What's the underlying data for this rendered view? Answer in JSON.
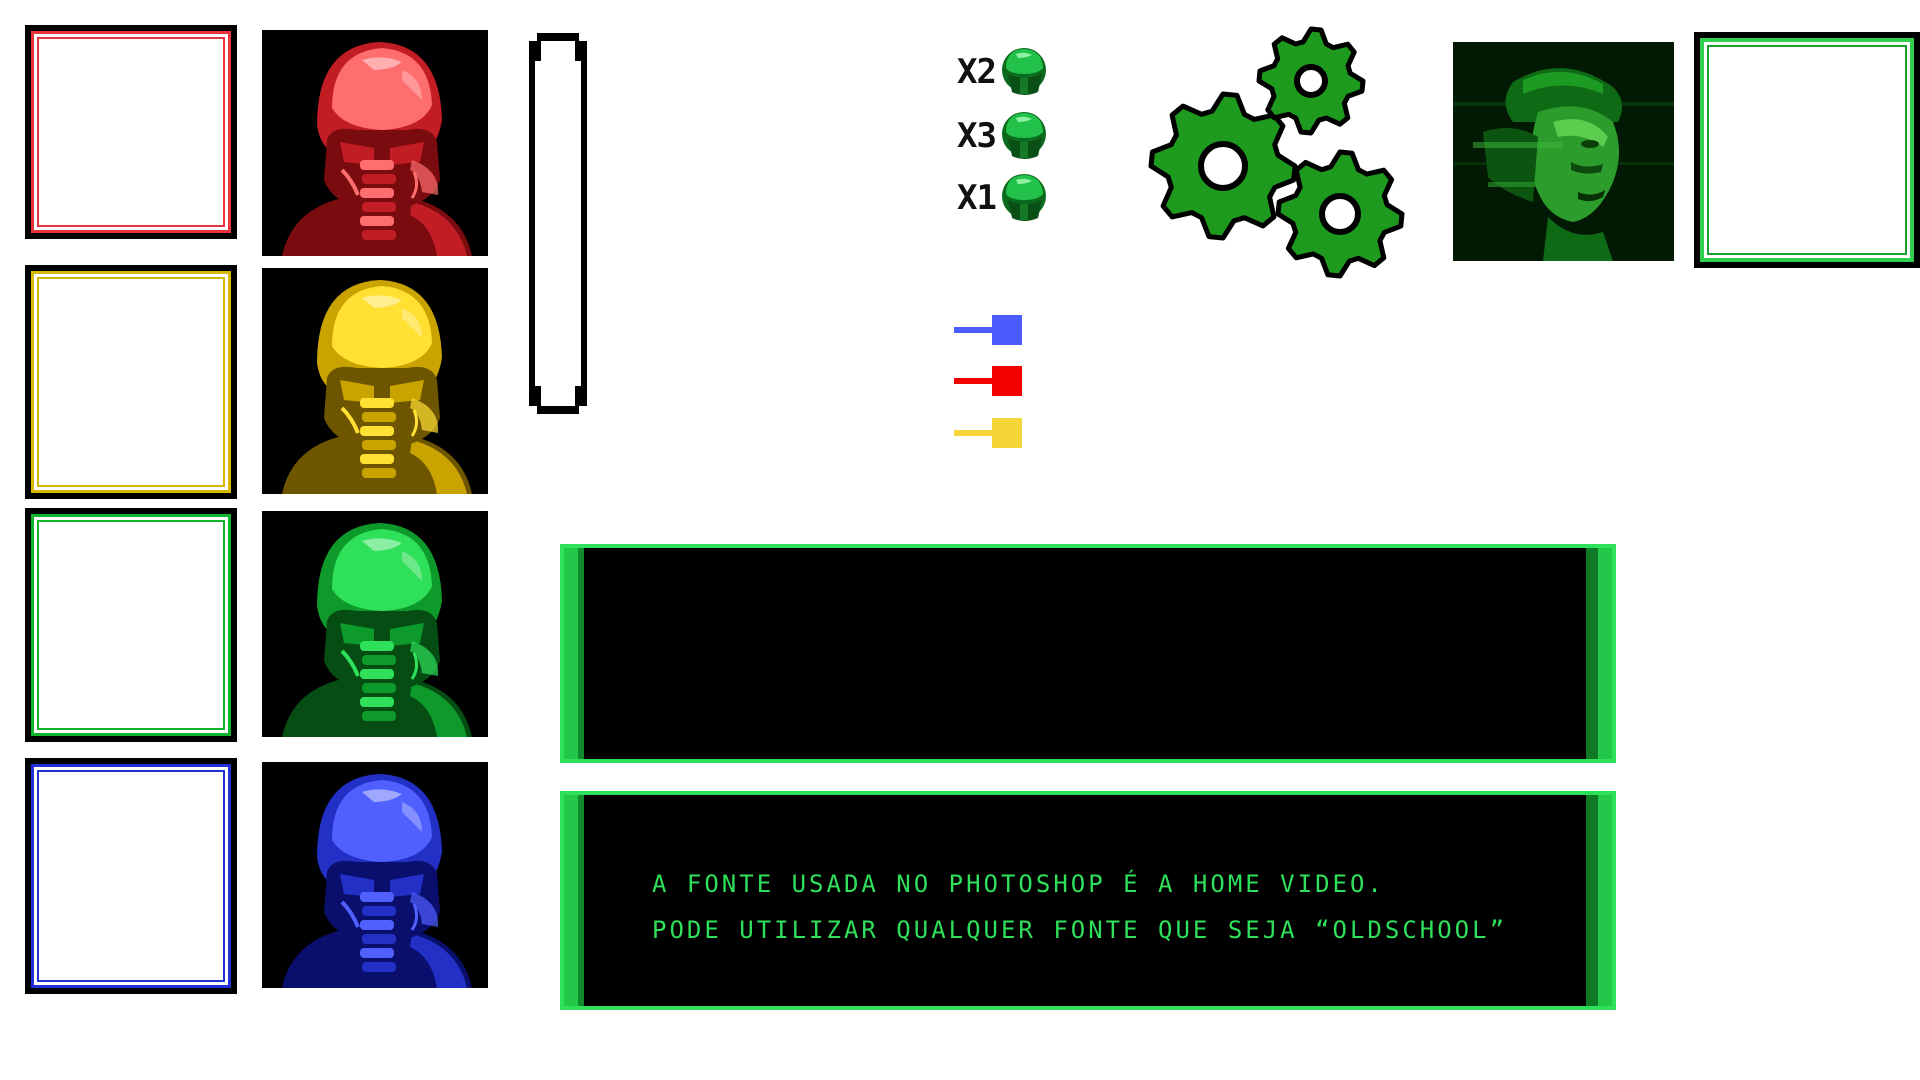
{
  "players": [
    {
      "id": "red",
      "color": "#e8353d",
      "inner": "#f24b4b",
      "dark": "#7a0c10",
      "mid": "#c21c24",
      "light": "#ff6e6e"
    },
    {
      "id": "yellow",
      "color": "#d7b800",
      "inner": "#e2c20a",
      "dark": "#6e5600",
      "mid": "#c9a400",
      "light": "#ffe033"
    },
    {
      "id": "green",
      "color": "#0fb52c",
      "inner": "#18c23a",
      "dark": "#064d14",
      "mid": "#0e9a2a",
      "light": "#2ee05a"
    },
    {
      "id": "blue",
      "color": "#2230d8",
      "inner": "#3442ea",
      "dark": "#0a0f6e",
      "mid": "#2230c6",
      "light": "#5060ff"
    }
  ],
  "lives": [
    {
      "label": "X2"
    },
    {
      "label": "X3"
    },
    {
      "label": "X1"
    }
  ],
  "plugs": [
    {
      "color": "#4a5bff"
    },
    {
      "color": "#f40000"
    },
    {
      "color": "#f5d53a"
    }
  ],
  "dialog": {
    "line1": "A FONTE USADA NO PHOTOSHOP É A HOME VIDEO.",
    "line2": "PODE UTILIZAR QUALQUER FONTE QUE SEJA “OLDSCHOOL”"
  },
  "colors": {
    "accent_green": "#2fe05a",
    "gear_green": "#1e9a1e"
  },
  "icons": {
    "gear": "gear-icon",
    "pilot": "pilot-helmet-icon"
  }
}
